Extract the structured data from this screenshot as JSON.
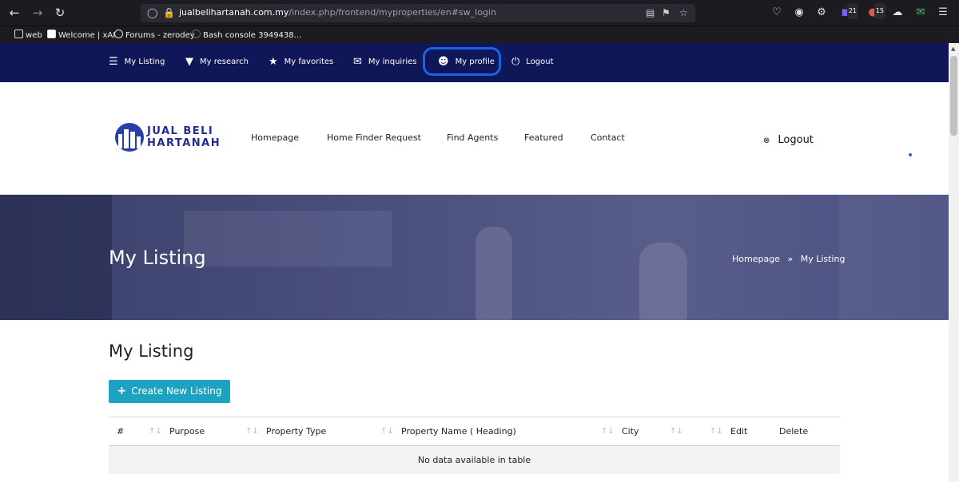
{
  "browser": {
    "url_main": "jualbelihartanah.com.my",
    "url_rest": "/index.php/frontend/myproperties/en#sw_login",
    "badges": [
      "21",
      "15"
    ],
    "bookmarks": [
      "web",
      "Welcome | xAI",
      "Forums - zerodey",
      "Bash console 3949438..."
    ]
  },
  "topbar": {
    "items": [
      {
        "label": "My Listing",
        "icon": "list-icon"
      },
      {
        "label": "My research",
        "icon": "filter-icon"
      },
      {
        "label": "My favorites",
        "icon": "star-icon"
      },
      {
        "label": "My inquiries",
        "icon": "envelope-icon"
      },
      {
        "label": "My profile",
        "icon": "user-icon"
      },
      {
        "label": "Logout",
        "icon": "power-icon"
      }
    ]
  },
  "header": {
    "logo_line1": "JUAL BELI",
    "logo_line2": "HARTANAH",
    "menu": [
      "Homepage",
      "Home Finder Request",
      "Find Agents",
      "Featured",
      "Contact"
    ],
    "logout": "Logout"
  },
  "hero": {
    "title": "My Listing",
    "crumb_home": "Homepage",
    "crumb_sep": "»",
    "crumb_current": "My Listing"
  },
  "content": {
    "title": "My Listing",
    "create_button": "Create New Listing",
    "columns": [
      "#",
      "Purpose",
      "Property Type",
      "Property Name ( Heading)",
      "City",
      "Edit",
      "Delete"
    ],
    "empty_message": "No data available in table"
  },
  "colors": {
    "navy": "#0f1759",
    "accent": "#1ea2c1",
    "highlight": "#1a63e8"
  }
}
